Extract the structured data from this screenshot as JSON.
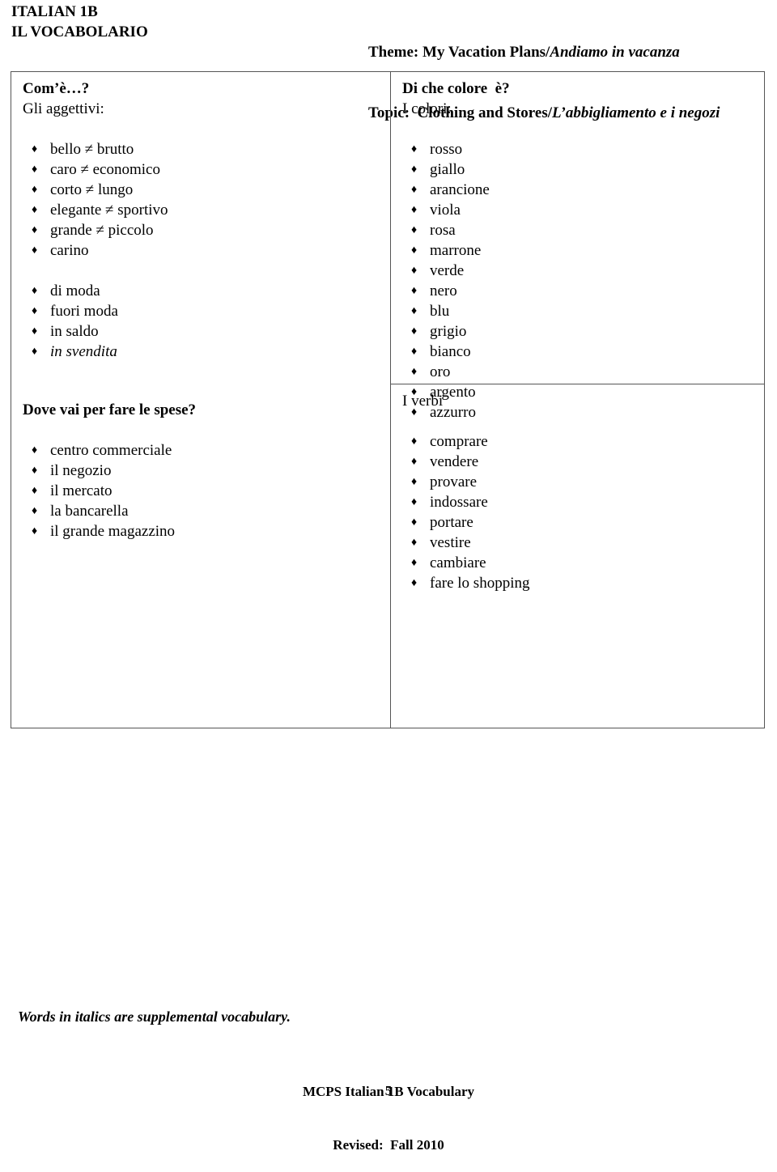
{
  "header": {
    "course": "ITALIAN 1B",
    "section": "IL VOCABOLARIO",
    "theme_label": "Theme: My Vacation Plans/",
    "theme_italic": "Andiamo in vacanza",
    "topic_label": "Topic:  Clothing and Stores/",
    "topic_italic": "L’abbigliamento e i negozi"
  },
  "adjectives": {
    "title": "Com’è…?",
    "subtitle": "Gli aggettivi:",
    "group1": [
      {
        "text": "bello ≠ brutto",
        "supplemental": false
      },
      {
        "text": "caro ≠ economico",
        "supplemental": false
      },
      {
        "text": "corto ≠ lungo",
        "supplemental": false
      },
      {
        "text": "elegante ≠ sportivo",
        "supplemental": false
      },
      {
        "text": "grande ≠ piccolo",
        "supplemental": false
      },
      {
        "text": "carino",
        "supplemental": false
      }
    ],
    "group2": [
      {
        "text": "di moda",
        "supplemental": false
      },
      {
        "text": "fuori moda",
        "supplemental": false
      },
      {
        "text": "in saldo",
        "supplemental": false
      },
      {
        "text": "in svendita",
        "supplemental": true
      }
    ]
  },
  "stores": {
    "title": "Dove vai per fare le spese?",
    "items": [
      {
        "text": "centro commerciale",
        "supplemental": false
      },
      {
        "text": "il negozio",
        "supplemental": false
      },
      {
        "text": "il mercato",
        "supplemental": false
      },
      {
        "text": "la bancarella",
        "supplemental": false
      },
      {
        "text": "il grande magazzino",
        "supplemental": false
      }
    ]
  },
  "colors": {
    "title": "Di che colore  è?",
    "subtitle": "I colori:",
    "items": [
      {
        "text": "rosso",
        "supplemental": false
      },
      {
        "text": "giallo",
        "supplemental": false
      },
      {
        "text": "arancione",
        "supplemental": false
      },
      {
        "text": "viola",
        "supplemental": false
      },
      {
        "text": "rosa",
        "supplemental": false
      },
      {
        "text": "marrone",
        "supplemental": false
      },
      {
        "text": "verde",
        "supplemental": false
      },
      {
        "text": "nero",
        "supplemental": false
      },
      {
        "text": "blu",
        "supplemental": false
      },
      {
        "text": "grigio",
        "supplemental": false
      },
      {
        "text": "bianco",
        "supplemental": false
      },
      {
        "text": "oro",
        "supplemental": false
      },
      {
        "text": "argento",
        "supplemental": false
      },
      {
        "text": "azzurro",
        "supplemental": false
      }
    ]
  },
  "verbs": {
    "title": "I verbi",
    "items": [
      {
        "text": "comprare",
        "supplemental": false
      },
      {
        "text": "vendere",
        "supplemental": false
      },
      {
        "text": "provare",
        "supplemental": false
      },
      {
        "text": "indossare",
        "supplemental": false
      },
      {
        "text": "portare",
        "supplemental": false
      },
      {
        "text": "vestire",
        "supplemental": false
      },
      {
        "text": "cambiare",
        "supplemental": false
      },
      {
        "text": "fare lo shopping",
        "supplemental": false
      }
    ]
  },
  "footer": {
    "italics_note": "Words in italics are supplemental vocabulary.",
    "source": "MCPS Italian 1B Vocabulary",
    "revision": "Revised:  Fall 2010",
    "page_number": "5"
  },
  "icons": {
    "bullet": "♦"
  }
}
